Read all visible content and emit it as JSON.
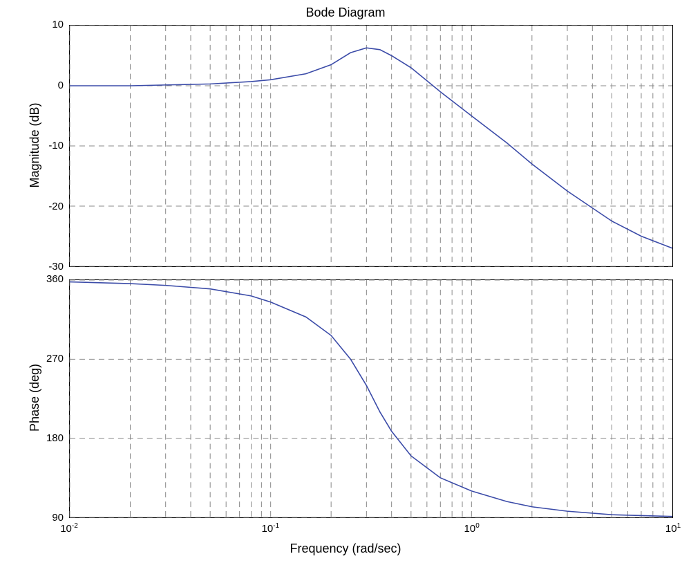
{
  "chart_data": [
    {
      "type": "line",
      "title": "Bode Diagram",
      "xlabel": "Frequency  (rad/sec)",
      "xlim": [
        0.01,
        10
      ],
      "xscale": "log",
      "panels": [
        {
          "ylabel": "Magnitude (dB)",
          "ylim": [
            -30,
            10
          ],
          "yticks": [
            -30,
            -20,
            -10,
            0,
            10
          ],
          "series": [
            {
              "name": "magnitude",
              "x": [
                0.01,
                0.02,
                0.05,
                0.08,
                0.1,
                0.15,
                0.2,
                0.25,
                0.3,
                0.35,
                0.4,
                0.5,
                0.7,
                1,
                1.5,
                2,
                3,
                5,
                7,
                10
              ],
              "y": [
                0,
                0,
                0.3,
                0.7,
                1,
                2,
                3.5,
                5.5,
                6.3,
                6,
                5,
                3,
                -1,
                -5,
                -9.5,
                -13,
                -17.5,
                -22.5,
                -25,
                -27
              ]
            }
          ]
        },
        {
          "ylabel": "Phase (deg)",
          "ylim": [
            90,
            360
          ],
          "yticks": [
            90,
            180,
            270,
            360
          ],
          "series": [
            {
              "name": "phase",
              "x": [
                0.01,
                0.02,
                0.03,
                0.05,
                0.08,
                0.1,
                0.15,
                0.2,
                0.25,
                0.3,
                0.35,
                0.4,
                0.5,
                0.7,
                1,
                1.5,
                2,
                3,
                5,
                7,
                10
              ],
              "y": [
                358,
                356,
                354,
                350,
                342,
                335,
                318,
                297,
                270,
                240,
                210,
                188,
                160,
                135,
                120,
                108,
                102,
                97,
                93,
                92,
                91
              ]
            }
          ]
        }
      ],
      "xticks": [
        0.01,
        0.1,
        1,
        10
      ],
      "xtick_labels": [
        "10^-2",
        "10^-1",
        "10^0",
        "10^1"
      ]
    }
  ],
  "title": "Bode Diagram",
  "mag_label": "Magnitude (dB)",
  "phase_label": "Phase (deg)",
  "x_label": "Frequency  (rad/sec)"
}
